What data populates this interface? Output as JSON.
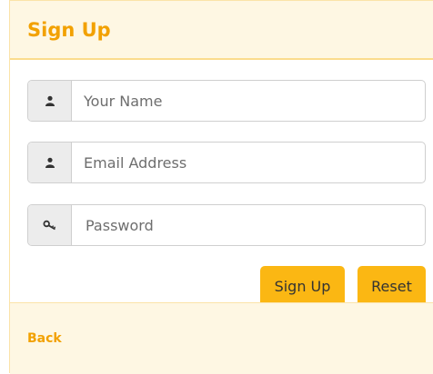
{
  "panel": {
    "title": "Sign Up"
  },
  "form": {
    "name_placeholder": "Your Name",
    "email_placeholder": "Email Address",
    "password_placeholder": "Password",
    "name_icon": "user-icon",
    "email_icon": "user-icon",
    "password_icon": "key-icon"
  },
  "actions": {
    "signup_label": "Sign Up",
    "reset_label": "Reset"
  },
  "footer": {
    "back_label": "Back"
  },
  "colors": {
    "accent": "#f2a100",
    "button": "#fbb713",
    "header_bg": "#fef7e3"
  }
}
